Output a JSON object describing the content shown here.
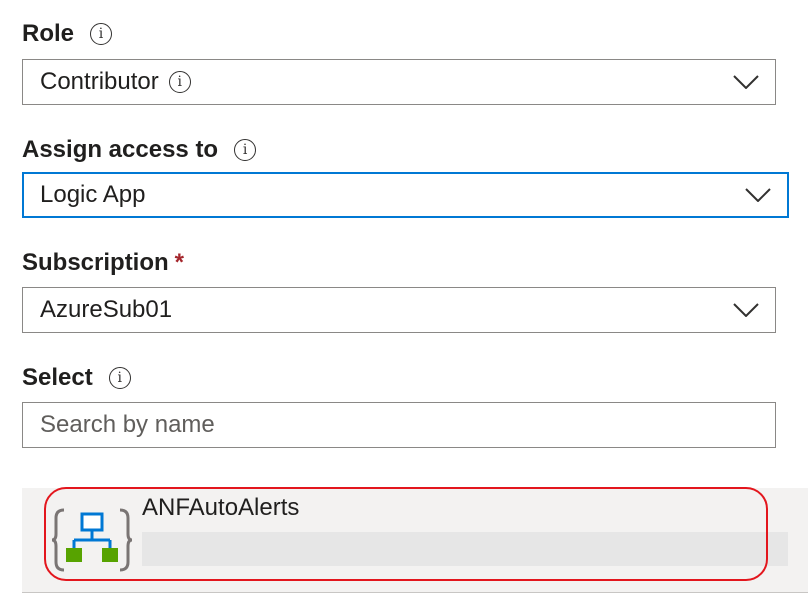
{
  "role": {
    "label": "Role",
    "value": "Contributor"
  },
  "assign_access": {
    "label": "Assign access to",
    "value": "Logic App"
  },
  "subscription": {
    "label": "Subscription",
    "required_mark": "*",
    "value": "AzureSub01"
  },
  "select": {
    "label": "Select",
    "placeholder": "Search by name"
  },
  "results": [
    {
      "name": "ANFAutoAlerts",
      "icon": "logic-app-icon"
    }
  ],
  "info_glyph": "i",
  "colors": {
    "focus_border": "#0078d4",
    "required": "#a4262c",
    "highlight": "#e3161d"
  }
}
